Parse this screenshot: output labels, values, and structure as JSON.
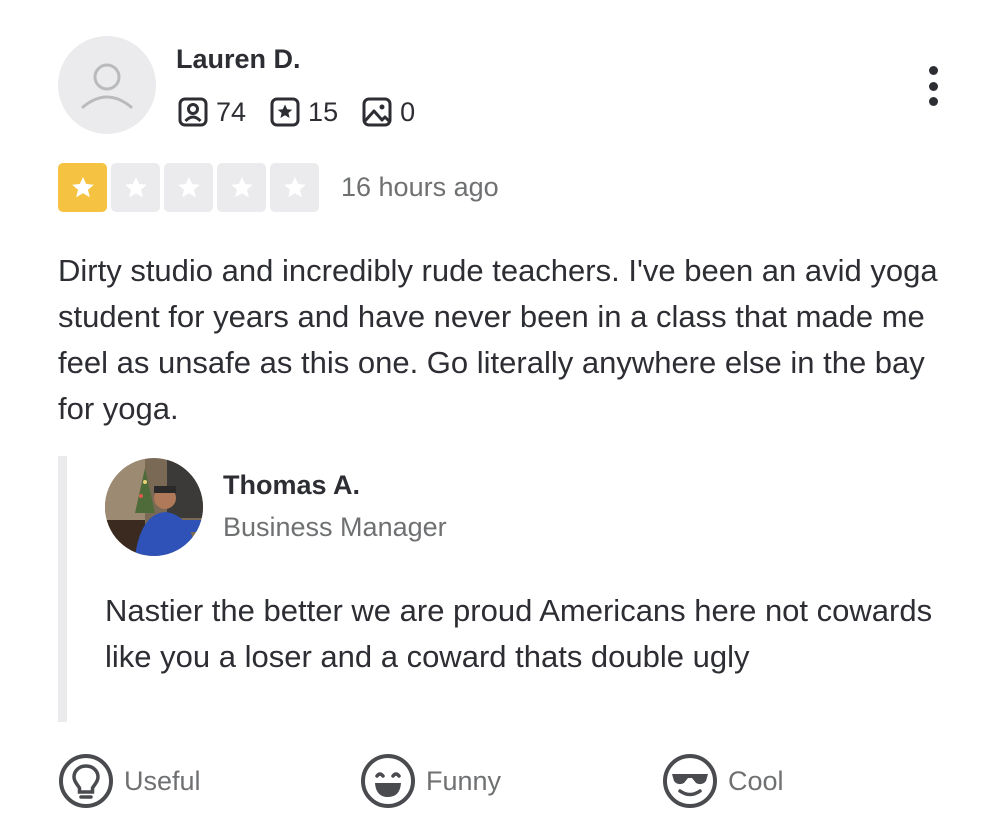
{
  "review": {
    "user": {
      "name": "Lauren D.",
      "friends_count": "74",
      "reviews_count": "15",
      "photos_count": "0"
    },
    "rating": 1,
    "rating_max": 5,
    "time_ago": "16 hours ago",
    "text": "Dirty studio and incredibly rude teachers. I've been an avid yoga student for years and have never been in a class that made me feel as unsafe as this one. Go literally anywhere else in the bay for yoga."
  },
  "owner_reply": {
    "name": "Thomas A.",
    "role": "Business Manager",
    "text": "Nastier the better we are proud Americans here not cowards like you a loser and a coward thats double ugly"
  },
  "reactions": [
    {
      "label": "Useful",
      "icon": "lightbulb-icon"
    },
    {
      "label": "Funny",
      "icon": "laughing-face-icon"
    },
    {
      "label": "Cool",
      "icon": "sunglasses-face-icon"
    }
  ],
  "colors": {
    "star_active": "#f5c341",
    "star_inactive": "#ebebed",
    "text_primary": "#2d2e33",
    "text_secondary": "#6e7072"
  }
}
